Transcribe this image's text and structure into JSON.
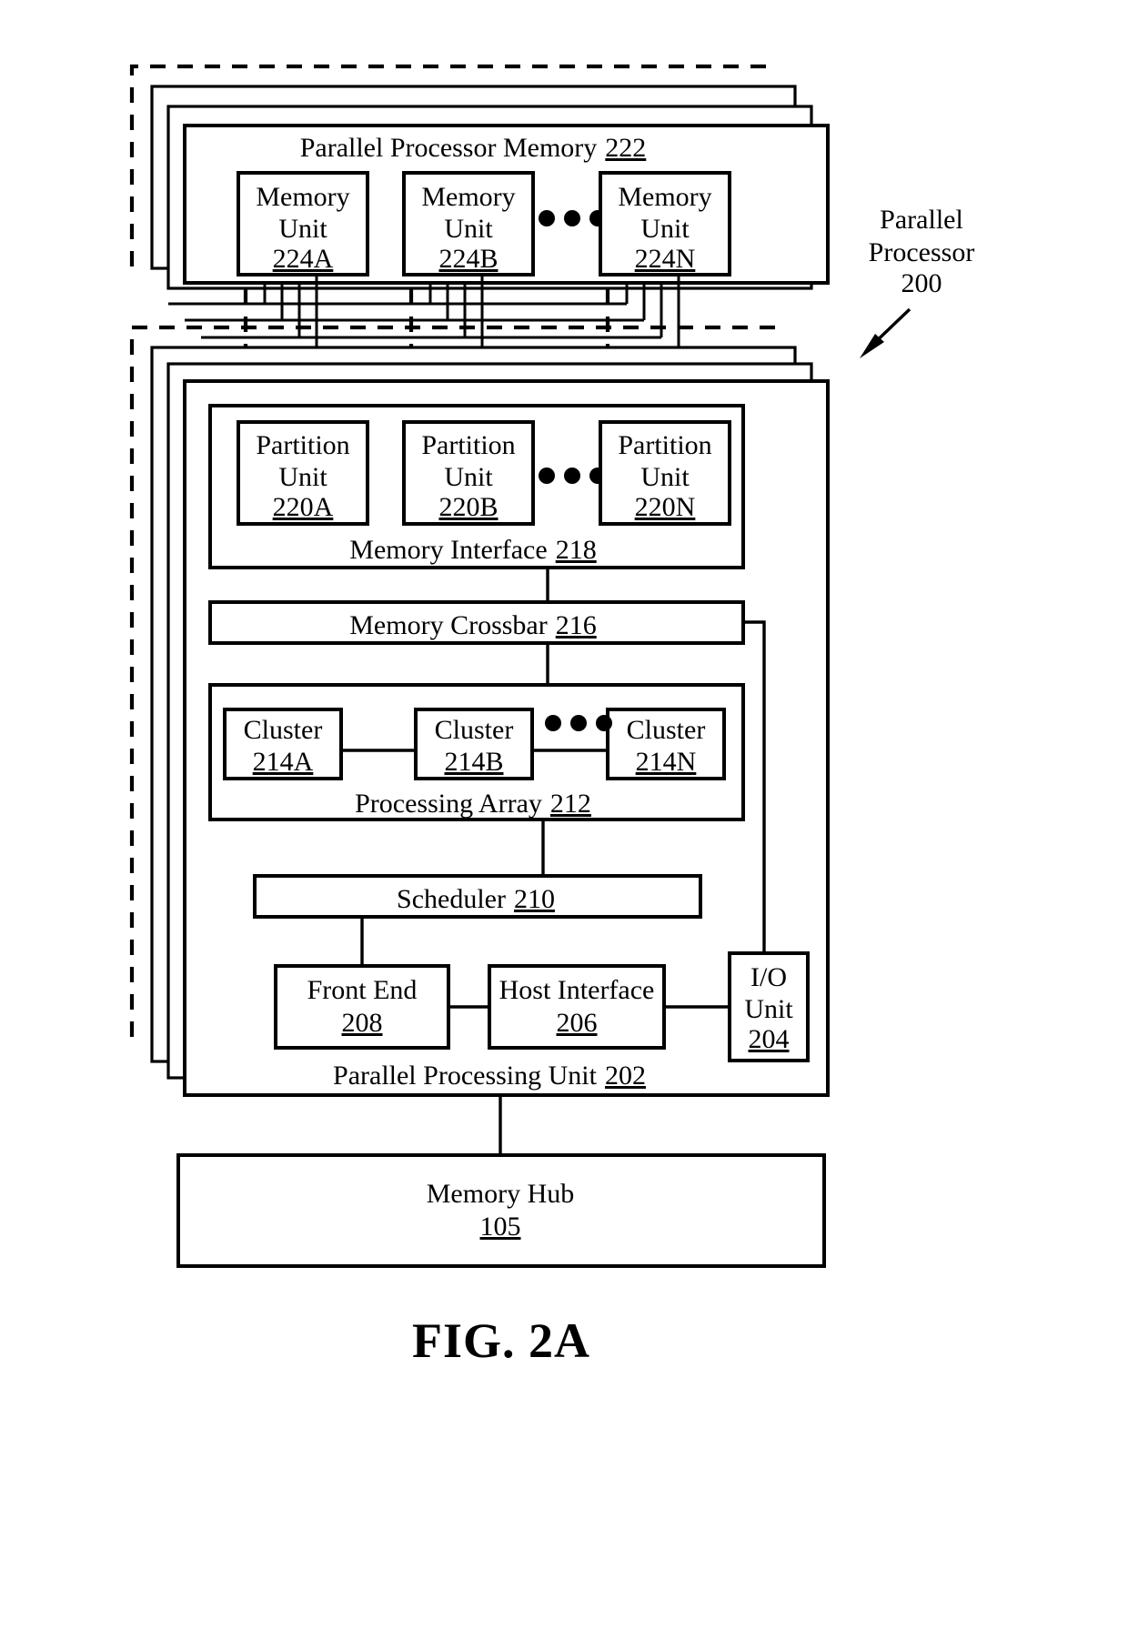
{
  "figure": {
    "caption": "FIG. 2A",
    "callout": {
      "line1": "Parallel",
      "line2": "Processor",
      "line3": "200"
    }
  },
  "memory_group": {
    "title_text": "Parallel Processor Memory",
    "title_ref": "222",
    "ellipsis": "• • •",
    "units": [
      {
        "line1": "Memory",
        "line2": "Unit",
        "ref": "224A"
      },
      {
        "line1": "Memory",
        "line2": "Unit",
        "ref": "224B"
      },
      {
        "line1": "Memory",
        "line2": "Unit",
        "ref": "224N"
      }
    ]
  },
  "ppu_group": {
    "title_text": "Parallel Processing Unit",
    "title_ref": "202",
    "memory_interface": {
      "title_text": "Memory Interface",
      "title_ref": "218",
      "ellipsis": "• • •",
      "partitions": [
        {
          "line1": "Partition",
          "line2": "Unit",
          "ref": "220A"
        },
        {
          "line1": "Partition",
          "line2": "Unit",
          "ref": "220B"
        },
        {
          "line1": "Partition",
          "line2": "Unit",
          "ref": "220N"
        }
      ]
    },
    "memory_crossbar": {
      "text": "Memory Crossbar",
      "ref": "216"
    },
    "processing_array": {
      "title_text": "Processing Array",
      "title_ref": "212",
      "ellipsis": "• • •",
      "clusters": [
        {
          "line1": "Cluster",
          "ref": "214A"
        },
        {
          "line1": "Cluster",
          "ref": "214B"
        },
        {
          "line1": "Cluster",
          "ref": "214N"
        }
      ]
    },
    "scheduler": {
      "text": "Scheduler",
      "ref": "210"
    },
    "front_end": {
      "line1": "Front End",
      "ref": "208"
    },
    "host_interface": {
      "line1": "Host Interface",
      "ref": "206"
    },
    "io_unit": {
      "line1": "I/O",
      "line2": "Unit",
      "ref": "204"
    }
  },
  "memory_hub": {
    "line1": "Memory Hub",
    "ref": "105"
  },
  "colors": {
    "stroke": "#000000",
    "fill": "#ffffff",
    "text": "#000000"
  }
}
